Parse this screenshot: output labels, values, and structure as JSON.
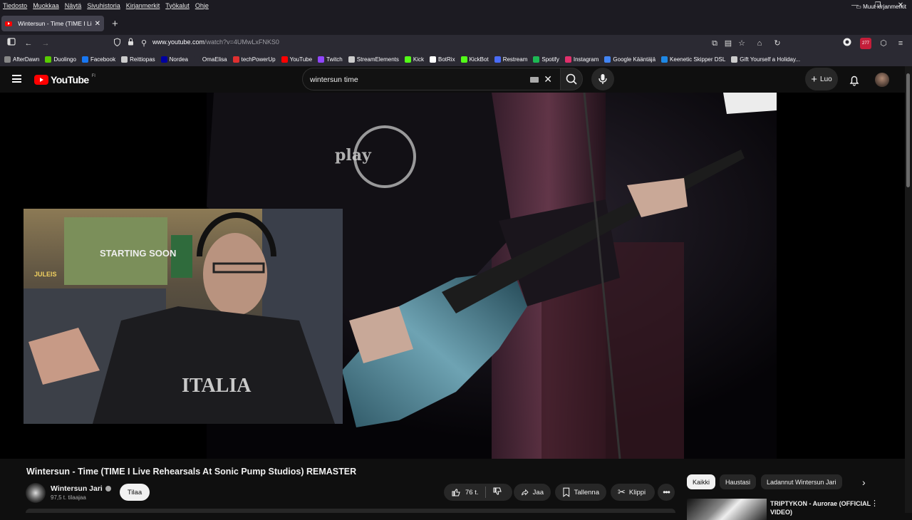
{
  "browser": {
    "menu": [
      "Tiedosto",
      "Muokkaa",
      "Näytä",
      "Sivuhistoria",
      "Kirjanmerkit",
      "Työkalut",
      "Ohje"
    ],
    "tab_title": "Wintersun - Time (TIME I Li",
    "url_domain": "www.youtube.com",
    "url_path": "/watch?v=4UMwLxFNKS0",
    "badge": "277",
    "bookmarks": [
      {
        "label": "AfterDawn",
        "color": "#888888"
      },
      {
        "label": "Duolingo",
        "color": "#58cc02"
      },
      {
        "label": "Facebook",
        "color": "#1877f2"
      },
      {
        "label": "Reittiopas",
        "color": "#cccccc"
      },
      {
        "label": "Nordea",
        "color": "#0000a0"
      },
      {
        "label": "OmaElisa",
        "color": "#2b2a33"
      },
      {
        "label": "techPowerUp",
        "color": "#e03030"
      },
      {
        "label": "YouTube",
        "color": "#ff0000"
      },
      {
        "label": "Twitch",
        "color": "#9146ff"
      },
      {
        "label": "StreamElements",
        "color": "#cccccc"
      },
      {
        "label": "Kick",
        "color": "#53fc18"
      },
      {
        "label": "BotRix",
        "color": "#ffffff"
      },
      {
        "label": "KickBot",
        "color": "#53fc18"
      },
      {
        "label": "Restream",
        "color": "#4a6cf7"
      },
      {
        "label": "Spotify",
        "color": "#1db954"
      },
      {
        "label": "Instagram",
        "color": "#e1306c"
      },
      {
        "label": "Google Kääntäjä",
        "color": "#4285f4"
      },
      {
        "label": "Keenetic Skipper DSL",
        "color": "#1e88e5"
      },
      {
        "label": "Gift Yourself a Holiday...",
        "color": "#cccccc"
      }
    ],
    "other_bookmarks": "Muut kirjanmerkit"
  },
  "youtube": {
    "logo_text": "YouTube",
    "logo_region": "FI",
    "search_value": "wintersun time",
    "create_label": "Luo",
    "video": {
      "overlay_logo_text": "play",
      "webcam_poster_text": "STARTING SOON",
      "webcam_poster_name": "JULEIS",
      "shirt_text": "ITALIA"
    },
    "title": "Wintersun - Time (TIME I Live Rehearsals At Sonic Pump Studios) REMASTER",
    "channel_name": "Wintersun Jari",
    "subscribers": "97,5 t. tilaajaa",
    "subscribe_label": "Tilaa",
    "likes": "76 t.",
    "share_label": "Jaa",
    "save_label": "Tallenna",
    "clip_label": "Klippi",
    "chips": [
      "Kaikki",
      "Haustasi",
      "Ladannut Wintersun Jari"
    ],
    "recommended": {
      "title": "TRIPTYKON - Aurorae (OFFICIAL VIDEO)"
    }
  }
}
